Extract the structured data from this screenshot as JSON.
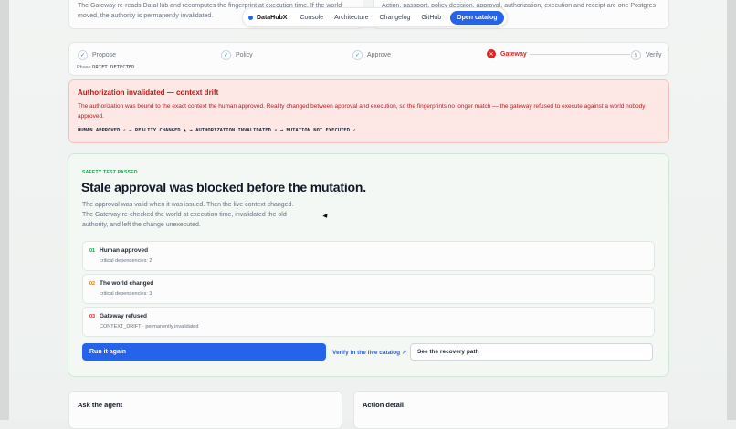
{
  "top_cards": {
    "left_text": "The Gateway re-reads DataHub and recomputes the fingerprint at execution time. If the world moved, the authority is permanently invalidated.",
    "right_text": "Action, passport, policy decision, approval, authorization, execution and receipt are one Postgres chain —"
  },
  "nav": {
    "brand": "DataHubX",
    "links": [
      "Console",
      "Architecture",
      "Changelog",
      "GitHub"
    ],
    "cta": "Open catalog"
  },
  "steps": {
    "items": [
      {
        "label": "Propose",
        "state": "done"
      },
      {
        "label": "Policy",
        "state": "done"
      },
      {
        "label": "Approve",
        "state": "done"
      },
      {
        "label": "Gateway",
        "state": "failed"
      },
      {
        "label": "Verify",
        "state": "pending",
        "number": "5"
      }
    ],
    "phase_label": "Phase",
    "phase_value": "DRIFT DETECTED"
  },
  "alert": {
    "title": "Authorization invalidated — context drift",
    "body": "The authorization was bound to the exact context the human approved. Reality changed between approval and execution, so the fingerprints no longer match — the gateway refused to execute against a world nobody approved.",
    "chain": "HUMAN APPROVED ✓ → REALITY CHANGED ▲ → AUTHORIZATION INVALIDATED ✕ → MUTATION NOT EXECUTED ✓"
  },
  "result": {
    "eyebrow": "SAFETY TEST PASSED",
    "title": "Stale approval was blocked before the mutation.",
    "desc_line1": "The approval was valid when it was issued. Then the live context changed.",
    "desc_line2": "The Gateway re-checked the world at execution time, invalidated the old",
    "desc_line3": "authority, and left the change unexecuted.",
    "rows": [
      {
        "num": "01",
        "title": "Human approved",
        "sub": "critical dependencies: 2",
        "color": "#16a34a"
      },
      {
        "num": "02",
        "title": "The world changed",
        "sub": "critical dependencies: 3",
        "color": "#d97706"
      },
      {
        "num": "03",
        "title": "Gateway refused",
        "sub": "CONTEXT_DRIFT · permanently invalidated",
        "color": "#dc2626"
      }
    ],
    "run_again": "Run it again",
    "verify_link": "Verify in the live catalog ↗",
    "recovery": "See the recovery path"
  },
  "bottom": {
    "ask_agent": "Ask the agent",
    "action_detail": "Action detail"
  }
}
